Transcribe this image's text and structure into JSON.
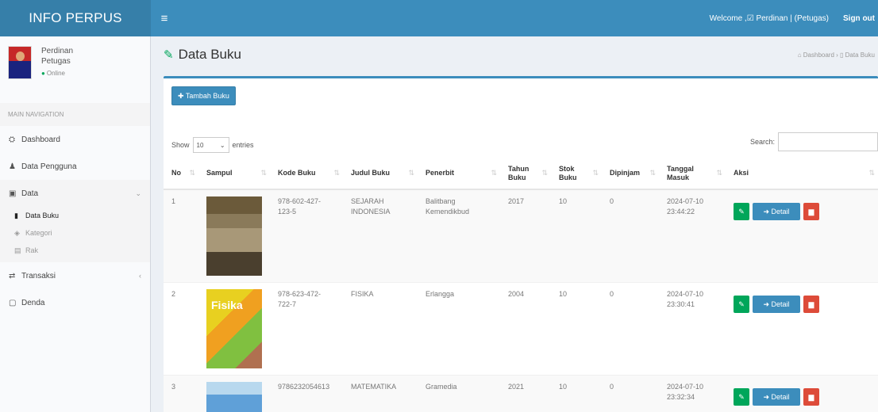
{
  "header": {
    "logo": "INFO PERPUS",
    "toggle_icon": "≡",
    "welcome": "Welcome ,☑ Perdinan | (Petugas)",
    "signout": "Sign out"
  },
  "sidebar": {
    "user_name": "Perdinan",
    "user_role": "Petugas",
    "status": "Online",
    "nav_header": "MAIN NAVIGATION",
    "items": [
      {
        "label": "Dashboard",
        "icon": "⛭"
      },
      {
        "label": "Data Pengguna",
        "icon": "♟"
      },
      {
        "label": "Data",
        "icon": "▣"
      },
      {
        "label": "Transaksi",
        "icon": "⇄"
      },
      {
        "label": "Denda",
        "icon": "▢"
      }
    ],
    "submenu": [
      {
        "label": "Data Buku",
        "icon": "▮"
      },
      {
        "label": "Kategori",
        "icon": "◈"
      },
      {
        "label": "Rak",
        "icon": "▤"
      }
    ]
  },
  "content": {
    "title": "Data Buku",
    "breadcrumb": "⌂ Dashboard › ▯ Data Buku",
    "add_button": "✚ Tambah Buku",
    "show_label": "Show",
    "entries_value": "10",
    "entries_label": "entries",
    "search_label": "Search:"
  },
  "table": {
    "headers": [
      "No",
      "Sampul",
      "Kode Buku",
      "Judul Buku",
      "Penerbit",
      "Tahun Buku",
      "Stok Buku",
      "Dipinjam",
      "Tanggal Masuk",
      "Aksi"
    ],
    "rows": [
      {
        "no": "1",
        "kode": "978-602-427-123-5",
        "judul": "SEJARAH INDONESIA",
        "penerbit": "Balitbang Kemendikbud",
        "tahun": "2017",
        "stok": "10",
        "dipinjam": "0",
        "tanggal": "2024-07-10 23:44:22"
      },
      {
        "no": "2",
        "kode": "978-623-472-722-7",
        "judul": "FISIKA",
        "penerbit": "Erlangga",
        "tahun": "2004",
        "stok": "10",
        "dipinjam": "0",
        "tanggal": "2024-07-10 23:30:41"
      },
      {
        "no": "3",
        "kode": "9786232054613",
        "judul": "MATEMATIKA",
        "penerbit": "Gramedia",
        "tahun": "2021",
        "stok": "10",
        "dipinjam": "0",
        "tanggal": "2024-07-10 23:32:34"
      }
    ],
    "cover2_text": "Fisika",
    "detail_label": "Detail"
  }
}
